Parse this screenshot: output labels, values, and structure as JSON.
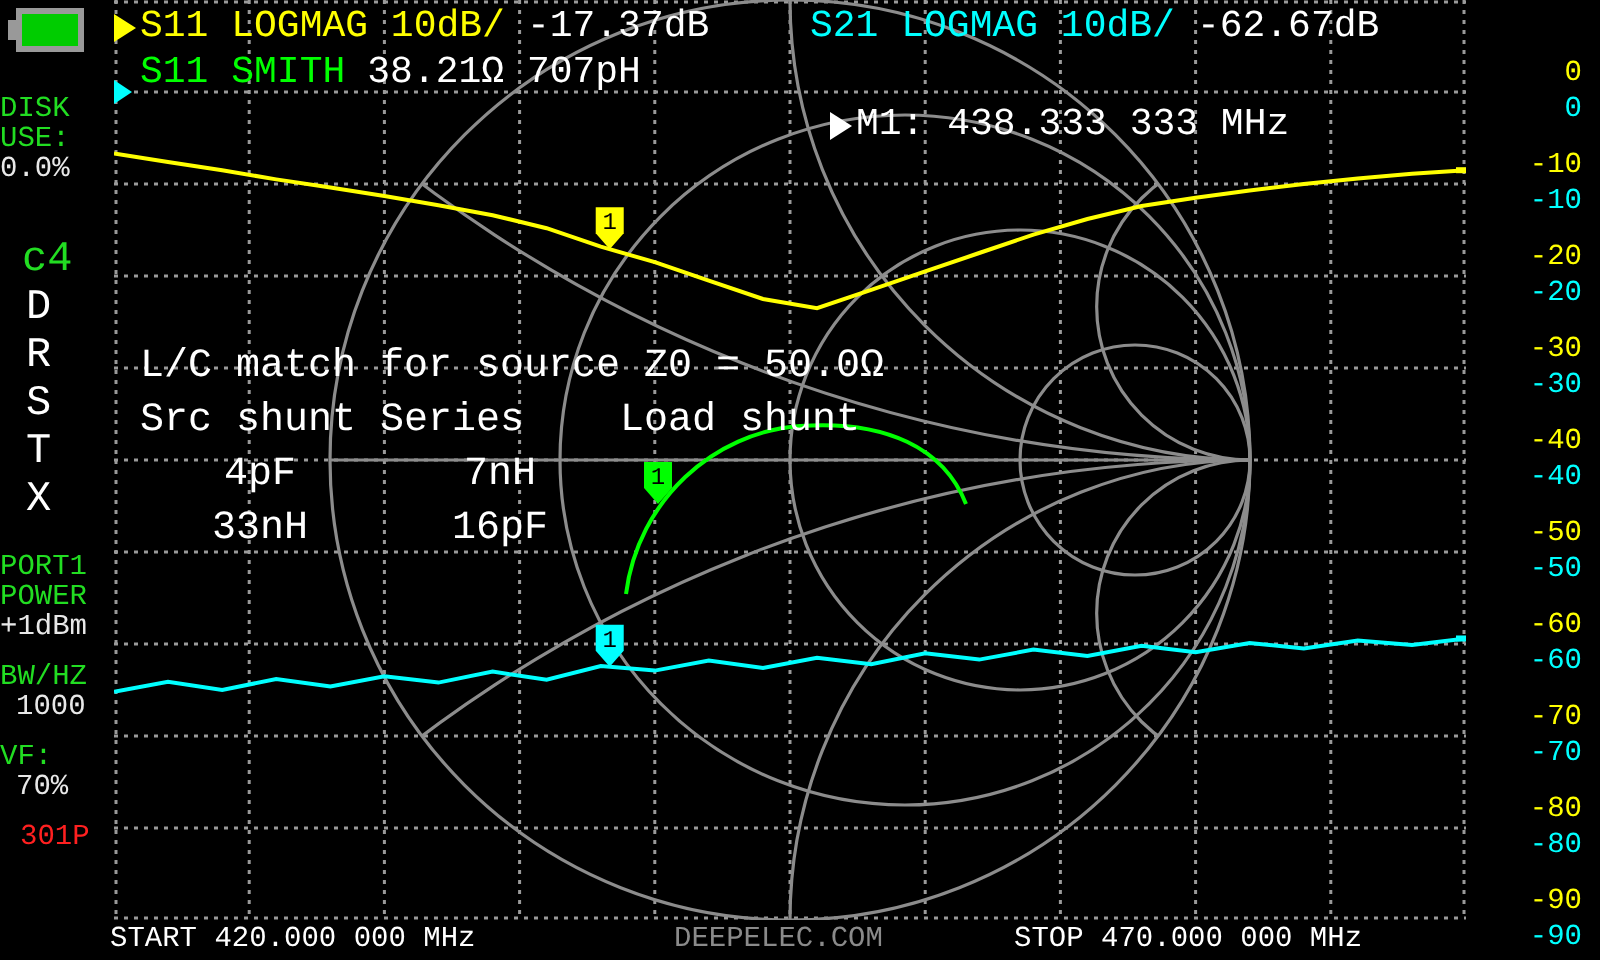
{
  "status": {
    "disk_label": "DISK",
    "disk_label_2": "USE:",
    "disk_value": "0.0%"
  },
  "calibration": {
    "slot": "c4",
    "flags": [
      "D",
      "R",
      "S",
      "T",
      "X"
    ]
  },
  "settings": [
    {
      "label": "PORT1"
    },
    {
      "label": "POWER",
      "value": "+1dBm"
    },
    {
      "label": "BW/HZ",
      "value": "1000"
    },
    {
      "label": "VF:",
      "value": "70%"
    }
  ],
  "points": "301P",
  "traces": [
    {
      "kind": "logmag",
      "selected": true,
      "label": "S11 LOGMAG 10dB/",
      "value": "-17.37dB",
      "color": "#ffff00",
      "marker": "1"
    },
    {
      "kind": "logmag",
      "selected": false,
      "label": "S21 LOGMAG 10dB/",
      "value": "-62.67dB",
      "color": "#00ffff",
      "marker": "1"
    },
    {
      "kind": "smith",
      "selected": false,
      "label": "S11 SMITH",
      "value": "38.21Ω 707pH",
      "color": "#00ff00",
      "marker": "1"
    }
  ],
  "y_axis": {
    "s11_ticks": [
      "0",
      "-10",
      "-20",
      "-30",
      "-40",
      "-50",
      "-60",
      "-70",
      "-80",
      "-90"
    ],
    "s21_ticks": [
      "0",
      "-10",
      "-20",
      "-30",
      "-40",
      "-50",
      "-60",
      "-70",
      "-80",
      "-90"
    ]
  },
  "marker_readout": {
    "selected": true,
    "text": "M1: 438.333 333 MHz"
  },
  "lc_match": {
    "title": "L/C match for source Z0 = 50.0Ω",
    "headers": [
      "Src shunt",
      "Series",
      "Load shunt"
    ],
    "rows": [
      [
        "4pF",
        "7nH"
      ],
      [
        "33nH",
        "16pF"
      ]
    ]
  },
  "footer": {
    "start": "START 420.000 000 MHz",
    "brand": "DEEPELEC.COM",
    "stop": "STOP 470.000 000 MHz"
  }
}
